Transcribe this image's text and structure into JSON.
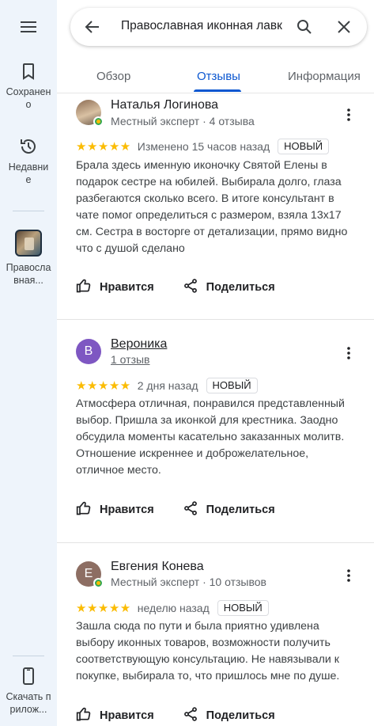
{
  "rail": {
    "saved_label": "Сохранено",
    "recent_label": "Недавние",
    "place_label": "Православная...",
    "download_label": "Скачать прилож..."
  },
  "search": {
    "query": "Православная иконная лавка"
  },
  "tabs": [
    {
      "label": "Обзор",
      "active": false
    },
    {
      "label": "Отзывы",
      "active": true
    },
    {
      "label": "Информация",
      "active": false
    }
  ],
  "action_labels": {
    "like": "Нравится",
    "share": "Поделиться"
  },
  "reviews": [
    {
      "author": "Наталья Логинова",
      "meta": "Местный эксперт · 4 отзыва",
      "stars": "★★★★★",
      "time": "Изменено 15 часов назад",
      "badge": "НОВЫЙ",
      "text": "Брала здесь именную иконочку Святой Елены в подарок сестре на юбилей. Выбирала долго, глаза разбегаются сколько всего. В итоге консультант в чате помог определиться с размером, взяла 13х17 см. Сестра в восторге от детализации, прямо видно что с душой сделано",
      "avatar_initial": ""
    },
    {
      "author": "Вероника",
      "meta": "1 отзыв",
      "stars": "★★★★★",
      "time": "2 дня назад",
      "badge": "НОВЫЙ",
      "text": "Атмосфера отличная, понравился представленный выбор. Пришла за иконкой для крестника. Заодно обсудила моменты касательно заказанных молитв. Отношение искреннее и доброжелательное, отличное место.",
      "avatar_initial": "В"
    },
    {
      "author": "Евгения Конева",
      "meta": "Местный эксперт · 10 отзывов",
      "stars": "★★★★★",
      "time": "неделю назад",
      "badge": "НОВЫЙ",
      "text": "Зашла сюда по пути и была приятно удивлена выбору иконных товаров, возможности получить соответствующую консультацию. Не навязывали к покупке, выбирала то, что пришлось мне по душе.",
      "avatar_initial": "Е"
    }
  ],
  "colors": {
    "accent": "#0b57d0",
    "star": "#fbbc04",
    "rail_bg": "#eef4fb",
    "avatar_veronika": "#7e57c2",
    "avatar_evgenia": "#8d6e63"
  }
}
